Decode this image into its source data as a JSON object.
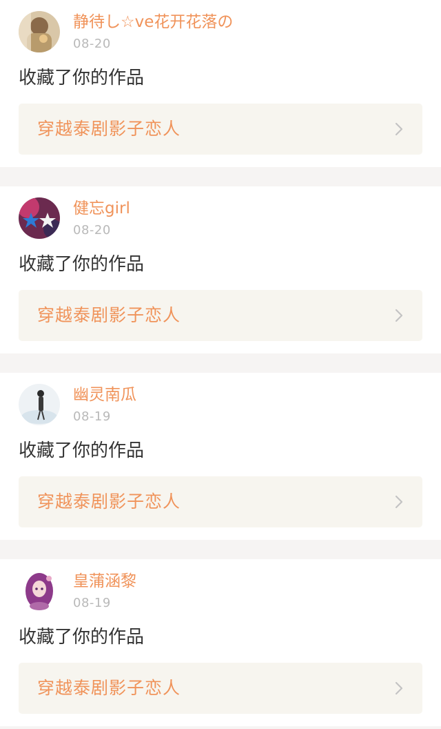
{
  "notifications": [
    {
      "username": "静待し☆ve花开花落の",
      "date": "08-20",
      "action": "收藏了你的作品",
      "work_title": "穿越泰剧影子恋人",
      "avatar_icon": "avatar-photo-icon"
    },
    {
      "username": "健忘girl",
      "date": "08-20",
      "action": "收藏了你的作品",
      "work_title": "穿越泰剧影子恋人",
      "avatar_icon": "avatar-stars-icon"
    },
    {
      "username": "幽灵南瓜",
      "date": "08-19",
      "action": "收藏了你的作品",
      "work_title": "穿越泰剧影子恋人",
      "avatar_icon": "avatar-figure-icon"
    },
    {
      "username": "皇蒲涵黎",
      "date": "08-19",
      "action": "收藏了你的作品",
      "work_title": "穿越泰剧影子恋人",
      "avatar_icon": "avatar-anime-girl-icon"
    }
  ],
  "colors": {
    "accent": "#f0935a",
    "date": "#b9b9b9",
    "text": "#333333",
    "link_bg": "#f7f5ef",
    "page_bg": "#f6f4f3"
  }
}
